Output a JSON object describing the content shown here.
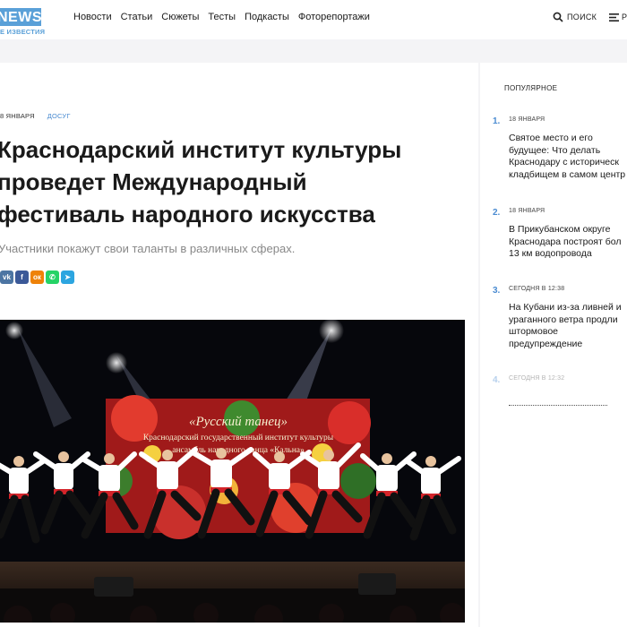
{
  "logo": {
    "text": "NEWS",
    "sub": "Е ИЗВЕСТИЯ"
  },
  "nav": [
    "Новости",
    "Статьи",
    "Сюжеты",
    "Тесты",
    "Подкасты",
    "Фоторепортажи"
  ],
  "search_label": "ПОИСК",
  "menu_label": "Р",
  "article": {
    "date": "8 ЯНВАРЯ",
    "category": "ДОСУГ",
    "title_lines": [
      "Краснодарский институт культуры",
      "проведет Международный",
      "фестиваль народного искусства"
    ],
    "lead": "Участники покажут свои таланты в различных сферах.",
    "share": [
      {
        "icon": "vk-icon",
        "glyph": "vk",
        "color": "#4c75a3"
      },
      {
        "icon": "facebook-icon",
        "glyph": "f",
        "color": "#3b5998"
      },
      {
        "icon": "odnoklassniki-icon",
        "glyph": "ок",
        "color": "#ee8208"
      },
      {
        "icon": "whatsapp-icon",
        "glyph": "✆",
        "color": "#25d366"
      },
      {
        "icon": "telegram-icon",
        "glyph": "➤",
        "color": "#2ca5e0"
      }
    ],
    "photo_banner": [
      "«Русский танец»",
      "Краснодарский государственный институт культуры",
      "ансамбль народного танца «Кальна»"
    ]
  },
  "sidebar": {
    "heading": "ПОПУЛЯРНОЕ",
    "items": [
      {
        "num": "1.",
        "date": "18 ЯНВАРЯ",
        "title": "Святое место и его\nбудущее: Что делать\nКраснодару с историческ\nкладбищем в самом центр"
      },
      {
        "num": "2.",
        "date": "18 ЯНВАРЯ",
        "title": "В Прикубанском округе\nКраснодара построят бол\n13 км водопровода"
      },
      {
        "num": "3.",
        "date": "СЕГОДНЯ В 12:38",
        "title": "На Кубани из-за ливней и\nураганного ветра продли\nштормовое\nпредупреждение"
      },
      {
        "num": "4.",
        "date": "СЕГОДНЯ В 12:32",
        "title": ""
      }
    ]
  }
}
